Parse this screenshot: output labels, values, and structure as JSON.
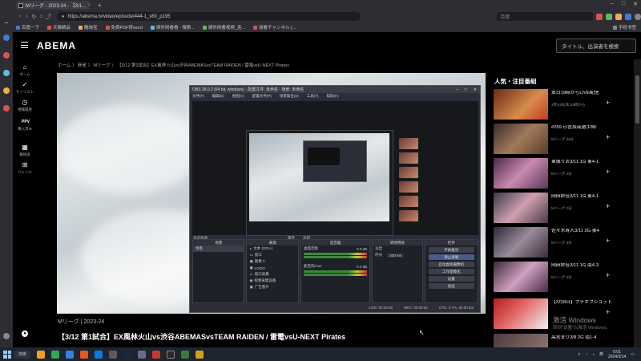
{
  "browser": {
    "tab_title": "Mリーグ - 2023-24 - 【3/1...",
    "url": "https://abema.tv/video/episode/444-1_s60_p195",
    "search_placeholder": "百度",
    "new_tab": "+",
    "bookmarks": [
      "百度一下",
      "天猫精品",
      "酷淘宝",
      "免费PDF转word",
      "嫁外网看看 - 搜索...",
      "嫁外网看视频_连...",
      "丽看チャンネル (..."
    ],
    "bookmarks_right": "手机书签",
    "accent": "#3b7dd8"
  },
  "abema": {
    "logo": "ABEMA",
    "search_placeholder": "タイトル、出演者を検索",
    "sidebar": [
      {
        "icon": "home-icon",
        "label": "ホーム"
      },
      {
        "icon": "check-icon",
        "label": "マイリスト"
      },
      {
        "icon": "history-icon",
        "label": "視聴履歴"
      },
      {
        "icon": "ppv-icon",
        "label": "購入済み"
      },
      {
        "icon": "grid-icon",
        "label": "番組表"
      },
      {
        "icon": "genre-icon",
        "label": "ジャンル"
      }
    ],
    "breadcrumb": "ホーム  〉 麻雀  〉 Mリーグ  〉 【3/12 第1試合】EX風林火山vs渋谷ABEMASvsTEAM RAIDEN / 雷電vsU-NEXT Pirates",
    "under_player": "Mリーグ | 2023-24",
    "video_title": "【3/12 第1試合】EX風林火山vs渋谷ABEMASvsTEAM RAIDEN / 雷電vsU-NEXT Pirates",
    "ranking_heading": "人気・注目番組",
    "ranking": [
      {
        "title": "本日19時からLIVE配信",
        "sub": "3月14日(木)19時から"
      },
      {
        "title": "#259 日吉辰哉選手降!",
        "sub": "Mリーグ\n24分"
      },
      {
        "title": "東城りお3/11 1G 東4-1",
        "sub": "Mリーグ\n2分"
      },
      {
        "title": "岡田紗佳3/11 1G 東4-1",
        "sub": "Mリーグ\n2分"
      },
      {
        "title": "佐々木寿人3/11 2G 東4",
        "sub": "Mリーグ\n3分"
      },
      {
        "title": "岡田紗佳3/11 1G 南4-3",
        "sub": "Mリーグ\n3分"
      },
      {
        "title": "【3月8日】プチオフショット",
        "sub": ""
      },
      {
        "title": "高宮まり3/8 2G 南1-4",
        "sub": ""
      }
    ],
    "watermark": "激活 Windows",
    "watermark_sub": "转到\"设置\"以激活 Windows。"
  },
  "obs": {
    "title": "OBS 26.0.2 (64 bit, windows) - 配置文件: 未命名 - 场景: 未命名",
    "menu": [
      "文件(F)",
      "编辑(E)",
      "视图(V)",
      "配置文件(P)",
      "场景集合(S)",
      "工具(T)",
      "帮助(H)"
    ],
    "no_source": "未选择源",
    "props": "属性",
    "filters": "滤镜",
    "panels": {
      "scenes": "场景",
      "sources": "来源",
      "mixer": "混音器",
      "transitions": "转场特效",
      "controls": "控件"
    },
    "scene_item": "场景",
    "sources": [
      "文本 (GDI+)",
      "窗口",
      "图像 2",
      "LOGO",
      "窗口采集",
      "视频采集设备",
      "广告图片"
    ],
    "mixer": [
      {
        "name": "桌面音频",
        "db": "0.0 dB"
      },
      {
        "name": "麦克风/Aux",
        "db": "0.0 dB"
      }
    ],
    "transition": "淡出",
    "duration_label": "时长",
    "duration": "300 ms",
    "controls": [
      "开始推流",
      "停止录制",
      "启动虚拟摄像机",
      "工作室模式",
      "设置",
      "退出"
    ],
    "status": [
      "LIVE: 00:00:00",
      "REC: 00:00:00",
      "CPU: 0.7%, 60.00 fps"
    ]
  },
  "taskbar": {
    "search": "搜索",
    "time": "0:01",
    "date": "2024/3/14",
    "ime": "英"
  }
}
